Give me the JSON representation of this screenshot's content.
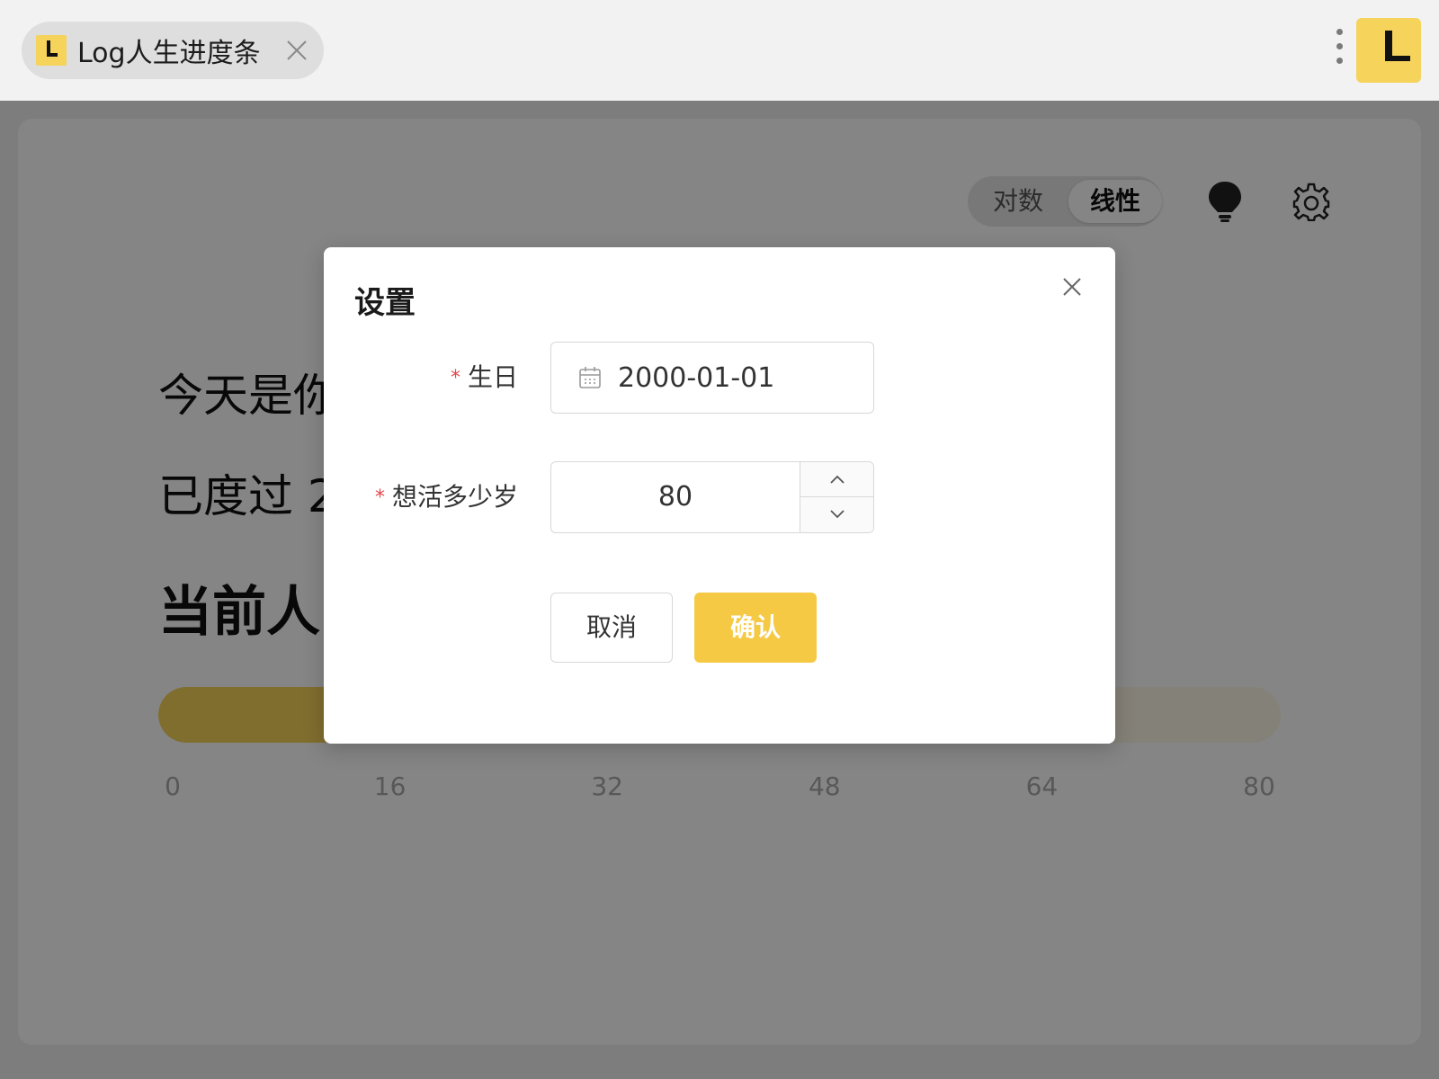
{
  "window": {
    "tab_title": "Log人生进度条"
  },
  "toolbar": {
    "mode_options": [
      "对数",
      "线性"
    ],
    "active_mode": "线性"
  },
  "main": {
    "line1": "今天是你",
    "line2": "已度过 2",
    "line3": "当前人",
    "progress_fraction": 0.3,
    "axis_ticks": [
      "0",
      "16",
      "32",
      "48",
      "64",
      "80"
    ]
  },
  "settings_dialog": {
    "title": "设置",
    "birthday_label": "生日",
    "birthday_value": "2000-01-01",
    "lifespan_label": "想活多少岁",
    "lifespan_value": "80",
    "cancel_label": "取消",
    "confirm_label": "确认",
    "required_mark": "*"
  },
  "colors": {
    "accent": "#f6d35a",
    "confirm": "#f6c945",
    "required": "#e5484d"
  }
}
